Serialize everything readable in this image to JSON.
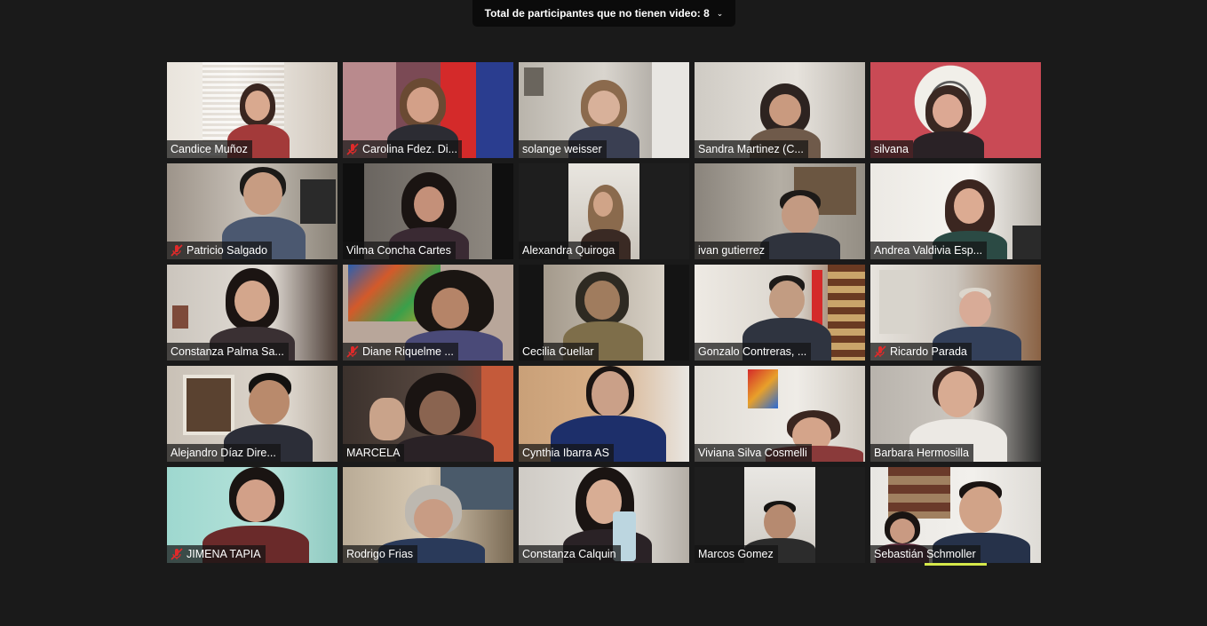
{
  "top_banner": {
    "label": "Total de participantes que no tienen video: 8",
    "icon": "chevron-down-icon"
  },
  "colors": {
    "background": "#1a1a1a",
    "active_speaker_border": "#d5e84a",
    "mute_icon": "#e02a2a"
  },
  "participants": [
    {
      "name": "Candice Muñoz",
      "muted": false
    },
    {
      "name": "Carolina Fdez. Di...",
      "muted": true
    },
    {
      "name": "solange weisser",
      "muted": false
    },
    {
      "name": "Sandra Martinez (C...",
      "muted": false
    },
    {
      "name": "silvana",
      "muted": false
    },
    {
      "name": "Patricio Salgado",
      "muted": true
    },
    {
      "name": "Vilma Concha Cartes",
      "muted": false
    },
    {
      "name": "Alexandra Quiroga",
      "muted": false
    },
    {
      "name": "ivan gutierrez",
      "muted": false,
      "active_speaker": true
    },
    {
      "name": "Andrea Valdivia Esp...",
      "muted": false
    },
    {
      "name": "Constanza Palma Sa...",
      "muted": false
    },
    {
      "name": "Diane Riquelme ...",
      "muted": true
    },
    {
      "name": "Cecilia Cuellar",
      "muted": false
    },
    {
      "name": "Gonzalo Contreras, ...",
      "muted": false
    },
    {
      "name": "Ricardo Parada",
      "muted": true
    },
    {
      "name": "Alejandro Díaz Dire...",
      "muted": false
    },
    {
      "name": "MARCELA",
      "muted": false
    },
    {
      "name": "Cynthia Ibarra AS",
      "muted": false
    },
    {
      "name": "Viviana Silva Cosmelli",
      "muted": false
    },
    {
      "name": "Barbara Hermosilla",
      "muted": false
    },
    {
      "name": "JIMENA TAPIA",
      "muted": true
    },
    {
      "name": "Rodrigo Frias",
      "muted": false
    },
    {
      "name": "Constanza Calquin",
      "muted": false
    },
    {
      "name": "Marcos Gomez",
      "muted": false
    },
    {
      "name": "Sebastián Schmoller",
      "muted": false
    }
  ]
}
